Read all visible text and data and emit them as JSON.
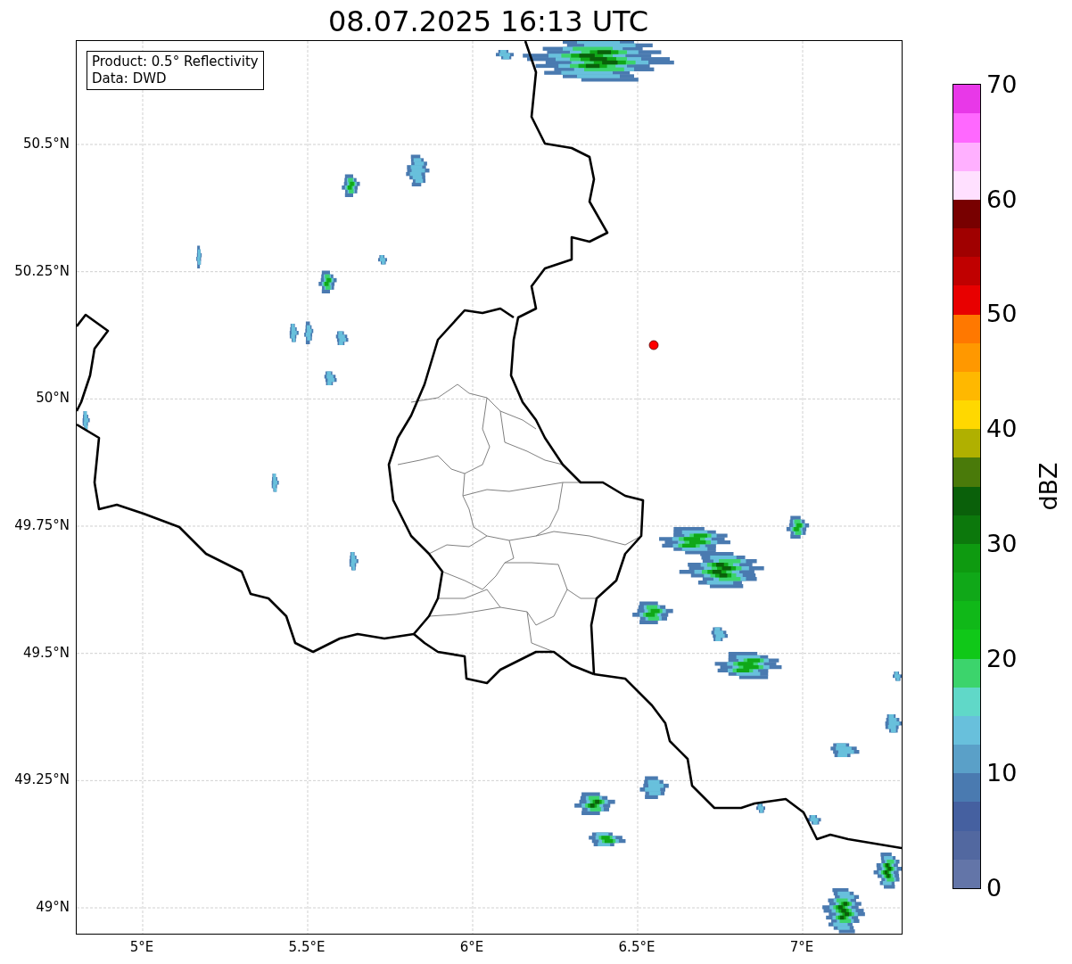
{
  "title": "08.07.2025 16:13 UTC",
  "info_box": {
    "lines": [
      "Product: 0.5° Reflectivity",
      "Data: DWD"
    ]
  },
  "map": {
    "lat_labels": [
      "50.5°N",
      "50.25°N",
      "50°N",
      "49.75°N",
      "49.5°N",
      "49.25°N",
      "49°N"
    ],
    "lon_labels": [
      "5°E",
      "5.5°E",
      "6°E",
      "6.5°E",
      "7°E"
    ]
  },
  "colorbar": {
    "label": "dBZ",
    "ticks": [
      "70",
      "60",
      "50",
      "40",
      "30",
      "20",
      "10",
      "0"
    ],
    "bands": [
      {
        "color": "#6375a8"
      },
      {
        "color": "#5268a0"
      },
      {
        "color": "#4560a0"
      },
      {
        "color": "#4a7ab0"
      },
      {
        "color": "#5aa0c8"
      },
      {
        "color": "#68c0dc"
      },
      {
        "color": "#60d8c8"
      },
      {
        "color": "#3cd46c"
      },
      {
        "color": "#10c818"
      },
      {
        "color": "#10b818"
      },
      {
        "color": "#10a818"
      },
      {
        "color": "#0e9a10"
      },
      {
        "color": "#0c780c"
      },
      {
        "color": "#0a600a"
      },
      {
        "color": "#4a7a0a"
      },
      {
        "color": "#b0b000"
      },
      {
        "color": "#ffd800"
      },
      {
        "color": "#ffb800"
      },
      {
        "color": "#ff9800"
      },
      {
        "color": "#ff7800"
      },
      {
        "color": "#e80000"
      },
      {
        "color": "#c00000"
      },
      {
        "color": "#a00000"
      },
      {
        "color": "#780000"
      },
      {
        "color": "#ffe0ff"
      },
      {
        "color": "#ffb0ff"
      },
      {
        "color": "#ff68ff"
      },
      {
        "color": "#e838e8"
      }
    ]
  }
}
